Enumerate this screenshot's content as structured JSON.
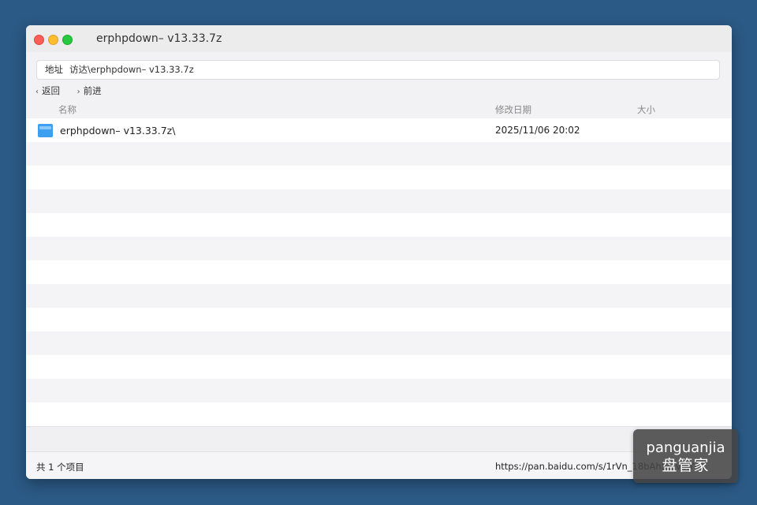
{
  "window": {
    "title": "erphpdown– v13.33.7z"
  },
  "address": {
    "label": "地址",
    "path": "访达\\erphpdown– v13.33.7z"
  },
  "nav": {
    "back_label": "返回",
    "forward_label": "前进"
  },
  "columns": {
    "name": "名称",
    "modified": "修改日期",
    "size": "大小"
  },
  "files": [
    {
      "name": "erphpdown– v13.33.7z\\",
      "modified": "2025/11/06 20:02",
      "size": "",
      "icon": "folder-icon"
    }
  ],
  "status": {
    "item_count": "共 1 个项目",
    "share_url": "https://pan.baidu.com/s/1rVn_18bAh5...vbpYC"
  },
  "watermark": {
    "line1": "panguanjia",
    "line2": "盘管家"
  },
  "colors": {
    "desktop": "#2b5a86",
    "folder": "#3d9ff0",
    "close": "#fe5f57",
    "minimize": "#febc2e",
    "zoom": "#28c840"
  }
}
